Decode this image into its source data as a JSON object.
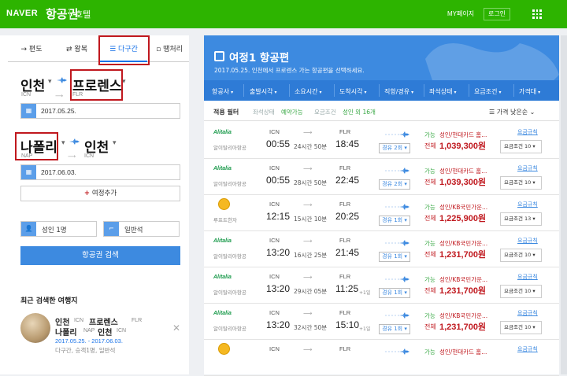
{
  "header": {
    "logo": "NAVER",
    "product": "항공권",
    "subnav": "호텔",
    "mypage": "MY페이지",
    "login": "로그인",
    "color": "#2db400"
  },
  "tabs": [
    {
      "label": "편도",
      "icon": "arrow-right-icon"
    },
    {
      "label": "왕복",
      "icon": "swap-icon"
    },
    {
      "label": "다구간",
      "icon": "list-icon",
      "active": true
    },
    {
      "label": "땡처리",
      "icon": "tag-icon"
    }
  ],
  "segment1": {
    "from_city": "인천",
    "from_code": "ICN",
    "to_city": "프로렌스",
    "to_code": "FLR",
    "date": "2017.05.25."
  },
  "segment2": {
    "from_city": "나폴리",
    "from_code": "NAP",
    "to_city": "인천",
    "to_code": "ICN",
    "date": "2017.06.03."
  },
  "add_route": "여정추가",
  "passengers": "성인 1명",
  "cabin": "일반석",
  "search_button": "항공권 검색",
  "recent": {
    "title": "최근 검색한 여행지",
    "line1_from": "인천",
    "line1_from_code": "ICN",
    "line1_to": "프로렌스",
    "line1_to_code": "FLR",
    "line2_from": "나폴리",
    "line2_from_code": "NAP",
    "line2_to": "인천",
    "line2_to_code": "ICN",
    "dates": "2017.05.25. - 2017.06.03.",
    "info": "다구간, 승객1명, 일반석"
  },
  "results": {
    "title": "여정1 항공편",
    "subtitle": "2017.05.25.  인천에서 프로렌스 가는 항공편을 선택하세요.",
    "filters": [
      "항공사",
      "출발시각",
      "소요시간",
      "도착시각",
      "직항/경유",
      "좌석상태",
      "요금조건",
      "가격대"
    ],
    "tag_label": "적용 필터",
    "tags": [
      "좌석상태",
      "예약가능",
      "요금조건",
      "성인 외 16개"
    ],
    "sort": "가격 낮은순",
    "flights": [
      {
        "airline": "Alitalia",
        "airline_name": "알이탈리아항공",
        "dep_code": "ICN",
        "dep_time": "00:55",
        "duration": "24시간 50분",
        "arr_code": "FLR",
        "arr_time": "18:45",
        "plus": "",
        "transfer": "경유 2회",
        "avail": "가능",
        "condition": "성인/현대카드 홈...",
        "total_label": "전체",
        "price": "1,039,300원",
        "fare_link": "요금규칙",
        "fee": "요금조건 10"
      },
      {
        "airline": "Alitalia",
        "airline_name": "알이탈리아항공",
        "dep_code": "ICN",
        "dep_time": "00:55",
        "duration": "28시간 50분",
        "arr_code": "FLR",
        "arr_time": "22:45",
        "plus": "",
        "transfer": "경유 2회",
        "avail": "가능",
        "condition": "성인/현대카드 홈...",
        "total_label": "전체",
        "price": "1,039,300원",
        "fare_link": "요금규칙",
        "fee": "요금조건 10"
      },
      {
        "airline": "Lufthansa",
        "airline_name": "루프트한자",
        "dep_code": "ICN",
        "dep_time": "12:15",
        "duration": "15시간 10분",
        "arr_code": "FLR",
        "arr_time": "20:25",
        "plus": "",
        "transfer": "경유 1회",
        "avail": "가능",
        "condition": "성인/KB국민가운...",
        "total_label": "전체",
        "price": "1,225,900원",
        "fare_link": "요금규칙",
        "fee": "요금조건 13"
      },
      {
        "airline": "Alitalia",
        "airline_name": "알이탈리아항공",
        "dep_code": "ICN",
        "dep_time": "13:20",
        "duration": "16시간 25분",
        "arr_code": "FLR",
        "arr_time": "21:45",
        "plus": "",
        "transfer": "경유 1회",
        "avail": "가능",
        "condition": "성인/KB국민가운...",
        "total_label": "전체",
        "price": "1,231,700원",
        "fare_link": "요금규칙",
        "fee": "요금조건 10"
      },
      {
        "airline": "Alitalia",
        "airline_name": "알이탈리아항공",
        "dep_code": "ICN",
        "dep_time": "13:20",
        "duration": "29시간 05분",
        "arr_code": "FLR",
        "arr_time": "11:25",
        "plus": "+1일",
        "transfer": "경유 1회",
        "avail": "가능",
        "condition": "성인/KB국민가운...",
        "total_label": "전체",
        "price": "1,231,700원",
        "fare_link": "요금규칙",
        "fee": "요금조건 10"
      },
      {
        "airline": "Alitalia",
        "airline_name": "알이탈리아항공",
        "dep_code": "ICN",
        "dep_time": "13:20",
        "duration": "32시간 50분",
        "arr_code": "FLR",
        "arr_time": "15:10",
        "plus": "+1일",
        "transfer": "경유 1회",
        "avail": "가능",
        "condition": "성인/KB국민가운...",
        "total_label": "전체",
        "price": "1,231,700원",
        "fare_link": "요금규칙",
        "fee": "요금조건 10"
      },
      {
        "airline": "Lufthansa",
        "airline_name": "",
        "dep_code": "ICN",
        "dep_time": "",
        "duration": "",
        "arr_code": "FLR",
        "arr_time": "",
        "plus": "",
        "transfer": "",
        "avail": "가능",
        "condition": "성인/현대카드 홈...",
        "total_label": "",
        "price": "",
        "fare_link": "요금규칙",
        "fee": ""
      }
    ]
  }
}
